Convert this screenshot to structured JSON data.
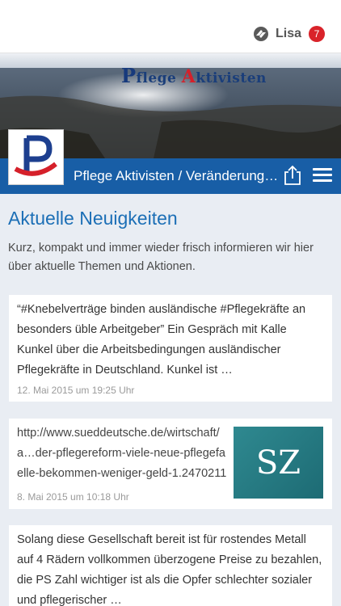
{
  "topbar": {
    "user_name": "Lisa",
    "notification_count": "7"
  },
  "banner": {
    "title_first_letter": "P",
    "title_first_rest": "flege ",
    "title_second_letter": "A",
    "title_second_rest": "ktivisten"
  },
  "navbar": {
    "title": "Pflege Aktivisten / Veränderungen"
  },
  "main": {
    "heading": "Aktuelle Neuigkeiten",
    "intro": "Kurz, kompakt und immer wieder frisch informieren wir hier über aktuelle Themen und Aktionen."
  },
  "posts": [
    {
      "text": "“#Knebelverträge binden ausländische #Pflegekräfte an besonders üble Arbeitgeber” Ein Gespräch mit Kalle Kunkel über die Arbeitsbedingungen ausländischer Pflegekräfte in Deutschland. Kunkel ist …",
      "date": "12. Mai 2015 um 19:25 Uhr"
    },
    {
      "text": "http://www.sueddeutsche.de/wirtschaft/a…der-pflegereform-viele-neue-pflegefaelle-bekommen-weniger-geld-1.2470211",
      "date": "8. Mai 2015 um 10:18 Uhr",
      "thumb_label": "SZ"
    },
    {
      "text": "Solang diese Gesellschaft bereit ist für rostendes Metall auf 4 Rädern vollkommen überzogene Preise zu bezahlen, die PS Zahl wichtiger ist als die Opfer schlechter sozialer und pflegerischer …"
    }
  ],
  "colors": {
    "accent": "#185ea6",
    "heading": "#1c6fb6",
    "badge": "#d9232a"
  },
  "icons": {
    "user": "user-switch-icon",
    "share": "share-icon",
    "menu": "hamburger-menu-icon"
  }
}
